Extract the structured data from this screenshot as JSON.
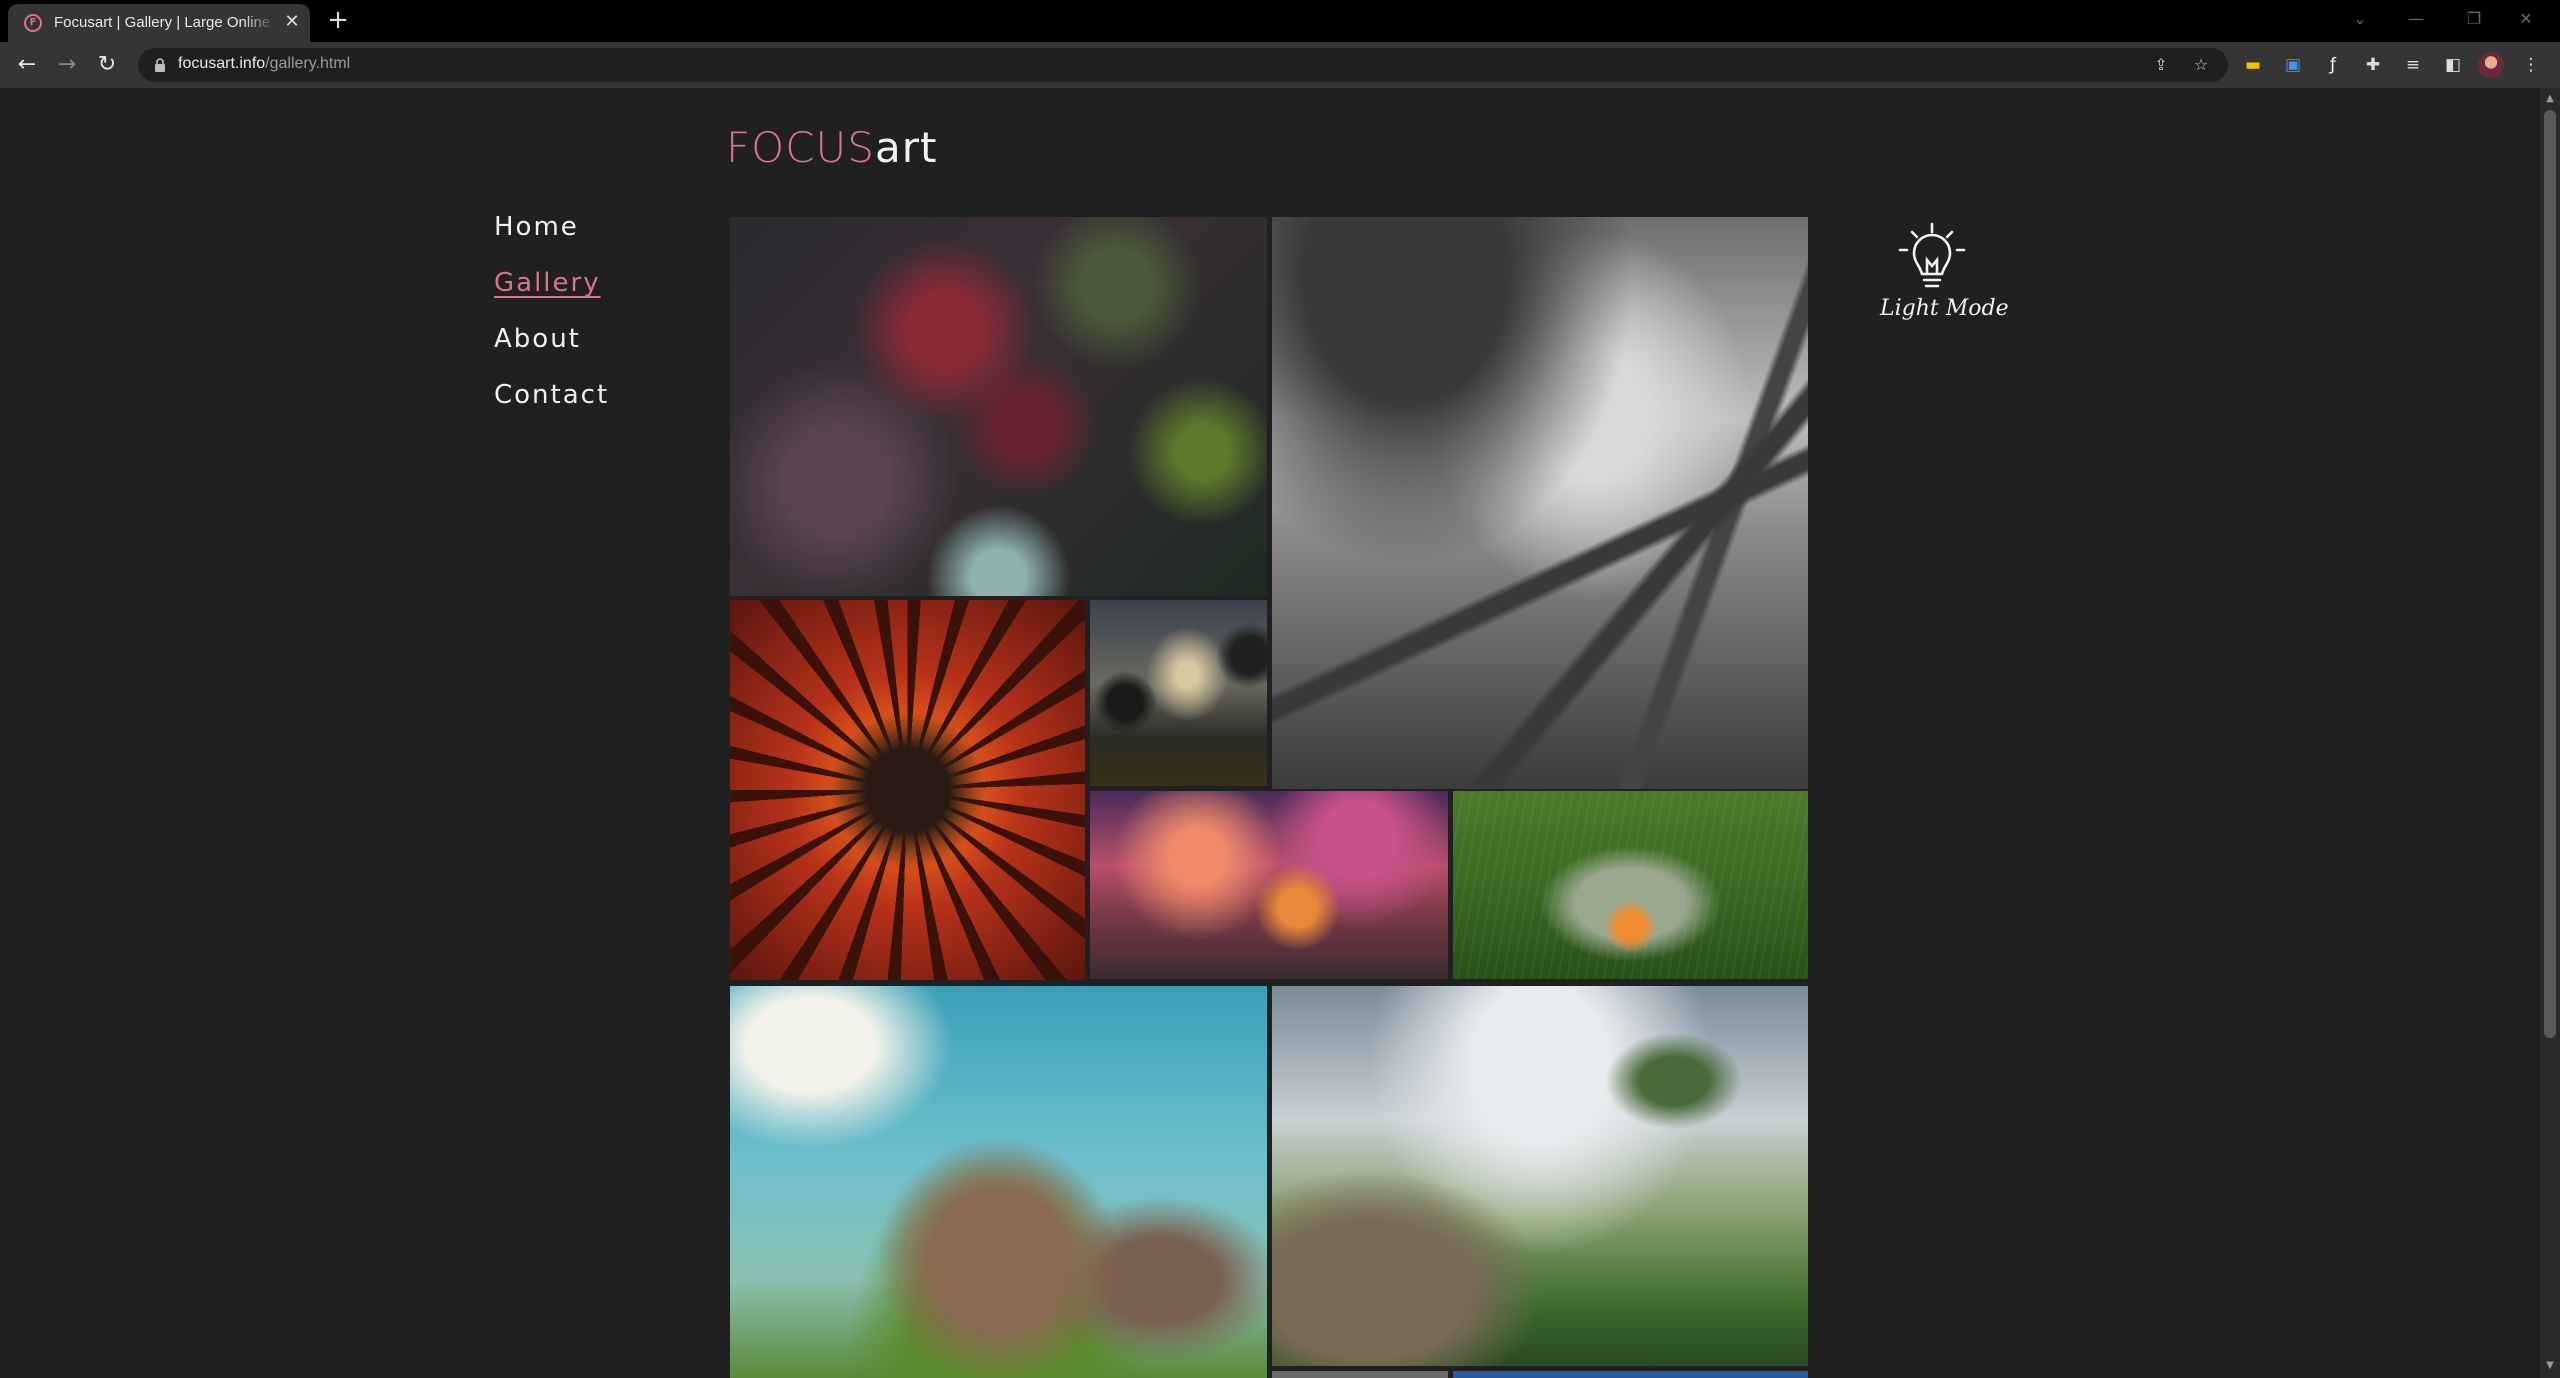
{
  "browser": {
    "tab_title": "Focusart | Gallery | Large Online Gallery",
    "tab_close_glyph": "✕",
    "new_tab_glyph": "+",
    "url_host": "focusart.info",
    "url_path": "/gallery.html"
  },
  "site": {
    "logo_focus": "FOCUS",
    "logo_art": "art",
    "accent_color": "#d9748b",
    "background_color": "#202020"
  },
  "nav": {
    "items": [
      {
        "label": "Home",
        "active": false
      },
      {
        "label": "Gallery",
        "active": true
      },
      {
        "label": "About",
        "active": false
      },
      {
        "label": "Contact",
        "active": false
      }
    ]
  },
  "theme_toggle": {
    "label": "Light Mode",
    "icon": "lightbulb-icon"
  },
  "gallery": {
    "images": [
      {
        "name": "gallery-image-biomech-creatures",
        "palette": "dark red mechanical creatures"
      },
      {
        "name": "gallery-image-gray-thorn-landscape",
        "palette": "grayscale spiked wasteland"
      },
      {
        "name": "gallery-image-red-tendril-face",
        "palette": "red tendrils"
      },
      {
        "name": "gallery-image-dusk-fireflies",
        "palette": "dark dusk sky"
      },
      {
        "name": "gallery-image-sunset-cottage",
        "palette": "purple orange sunset"
      },
      {
        "name": "gallery-image-rainy-campfire-cats",
        "palette": "green rain"
      },
      {
        "name": "gallery-image-fantasy-house-towers",
        "palette": "blue sky castle"
      },
      {
        "name": "gallery-image-misty-valley-waterfall",
        "palette": "misty green"
      }
    ]
  }
}
